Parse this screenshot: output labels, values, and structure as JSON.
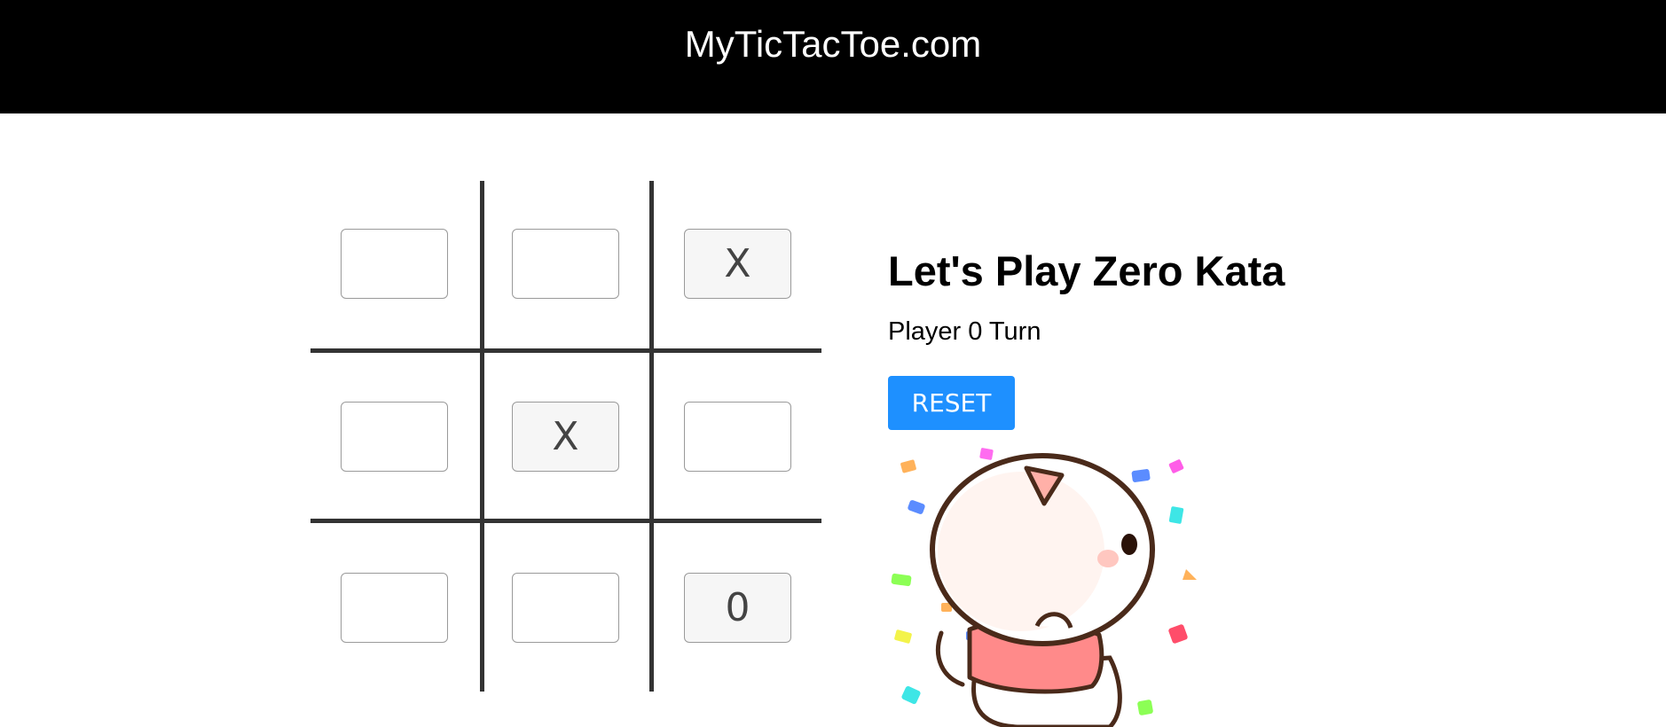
{
  "header": {
    "brand": "MyTicTacToe.com"
  },
  "board": {
    "cells": [
      "",
      "",
      "X",
      "",
      "X",
      "",
      "",
      "",
      "0"
    ]
  },
  "panel": {
    "title": "Let's Play Zero Kata",
    "status": "Player 0 Turn",
    "reset_label": "RESET"
  },
  "colors": {
    "navbar": "#000000",
    "button": "#1e90ff",
    "grid_line": "#333333"
  },
  "image": {
    "icon": "cat-celebration-gif"
  }
}
